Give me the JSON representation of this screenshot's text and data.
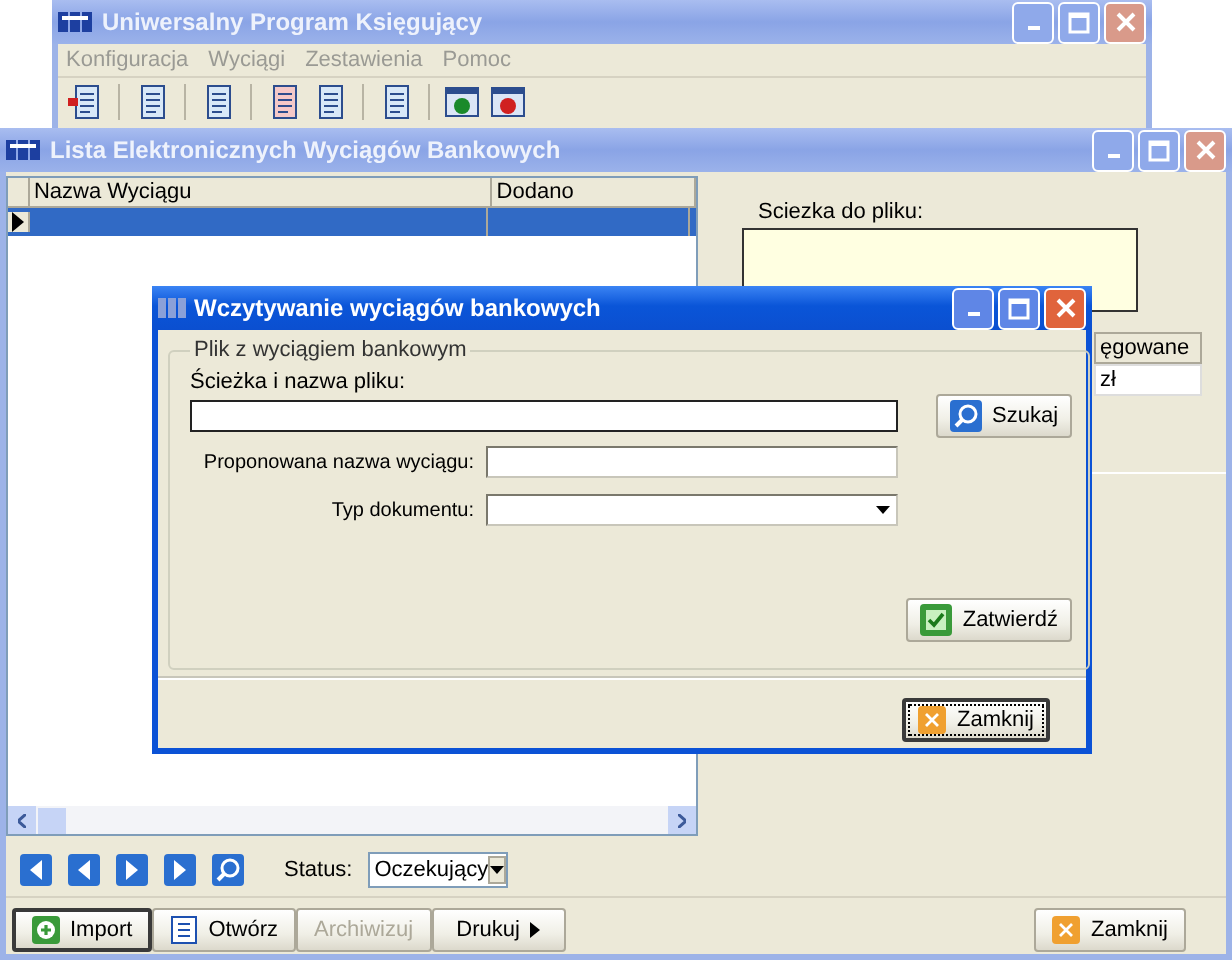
{
  "app_window": {
    "title": "Uniwersalny Program Księgujący",
    "menu": [
      "Konfiguracja",
      "Wyciągi",
      "Zestawienia",
      "Pomoc"
    ]
  },
  "list_window": {
    "title": "Lista Elektronicznych Wyciągów Bankowych",
    "columns": [
      "Nazwa Wyciągu",
      "Dodano"
    ],
    "rows": [
      {
        "selected": true
      }
    ],
    "path_label": "Sciezka do pliku:",
    "side_columns": [
      "ęgowane"
    ],
    "side_cells": [
      "zł"
    ],
    "status": {
      "label": "Status:",
      "value": "Oczekujący"
    },
    "buttons": [
      {
        "label": "Import",
        "kind": "add",
        "disabled": false
      },
      {
        "label": "Otwórz",
        "kind": "open",
        "disabled": false
      },
      {
        "label": "Archiwizuj",
        "kind": "plain",
        "disabled": true
      },
      {
        "label": "Drukuj",
        "kind": "menu",
        "disabled": false
      }
    ],
    "close_button": "Zamknij"
  },
  "dialog": {
    "title": "Wczytywanie wyciągów bankowych",
    "group": "Plik z wyciągiem bankowym",
    "path_label": "Ścieżka i nazwa pliku:",
    "name_label": "Proponowana nazwa wyciągu:",
    "type_label": "Typ dokumentu:",
    "search_button": "Szukaj",
    "confirm_button": "Zatwierdź",
    "close_button": "Zamknij"
  }
}
